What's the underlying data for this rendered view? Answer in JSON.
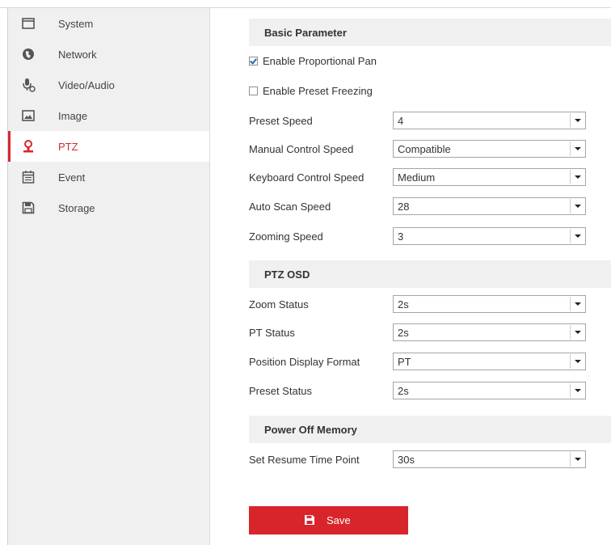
{
  "sidebar": {
    "items": [
      {
        "label": "System",
        "icon": "monitor-icon"
      },
      {
        "label": "Network",
        "icon": "globe-icon"
      },
      {
        "label": "Video/Audio",
        "icon": "microphone-icon"
      },
      {
        "label": "Image",
        "icon": "image-icon"
      },
      {
        "label": "PTZ",
        "icon": "ptz-camera-icon",
        "active": true
      },
      {
        "label": "Event",
        "icon": "calendar-icon"
      },
      {
        "label": "Storage",
        "icon": "floppy-disk-icon"
      }
    ]
  },
  "basic": {
    "title": "Basic Parameter",
    "enable_proportional_pan": {
      "label": "Enable Proportional Pan",
      "checked": true
    },
    "enable_preset_freezing": {
      "label": "Enable Preset Freezing",
      "checked": false
    },
    "preset_speed": {
      "label": "Preset Speed",
      "value": "4"
    },
    "manual_control_speed": {
      "label": "Manual Control Speed",
      "value": "Compatible"
    },
    "keyboard_control_speed": {
      "label": "Keyboard Control Speed",
      "value": "Medium"
    },
    "auto_scan_speed": {
      "label": "Auto Scan Speed",
      "value": "28"
    },
    "zooming_speed": {
      "label": "Zooming Speed",
      "value": "3"
    }
  },
  "osd": {
    "title": "PTZ OSD",
    "zoom_status": {
      "label": "Zoom Status",
      "value": "2s"
    },
    "pt_status": {
      "label": "PT Status",
      "value": "2s"
    },
    "position_display_format": {
      "label": "Position Display Format",
      "value": "PT"
    },
    "preset_status": {
      "label": "Preset Status",
      "value": "2s"
    }
  },
  "power": {
    "title": "Power Off Memory",
    "resume_time_point": {
      "label": "Set Resume Time Point",
      "value": "30s"
    }
  },
  "save_label": "Save",
  "colors": {
    "accent": "#d7252b",
    "sidebar_bg": "#f0f0f0",
    "section_bg": "#f0f0f0"
  }
}
